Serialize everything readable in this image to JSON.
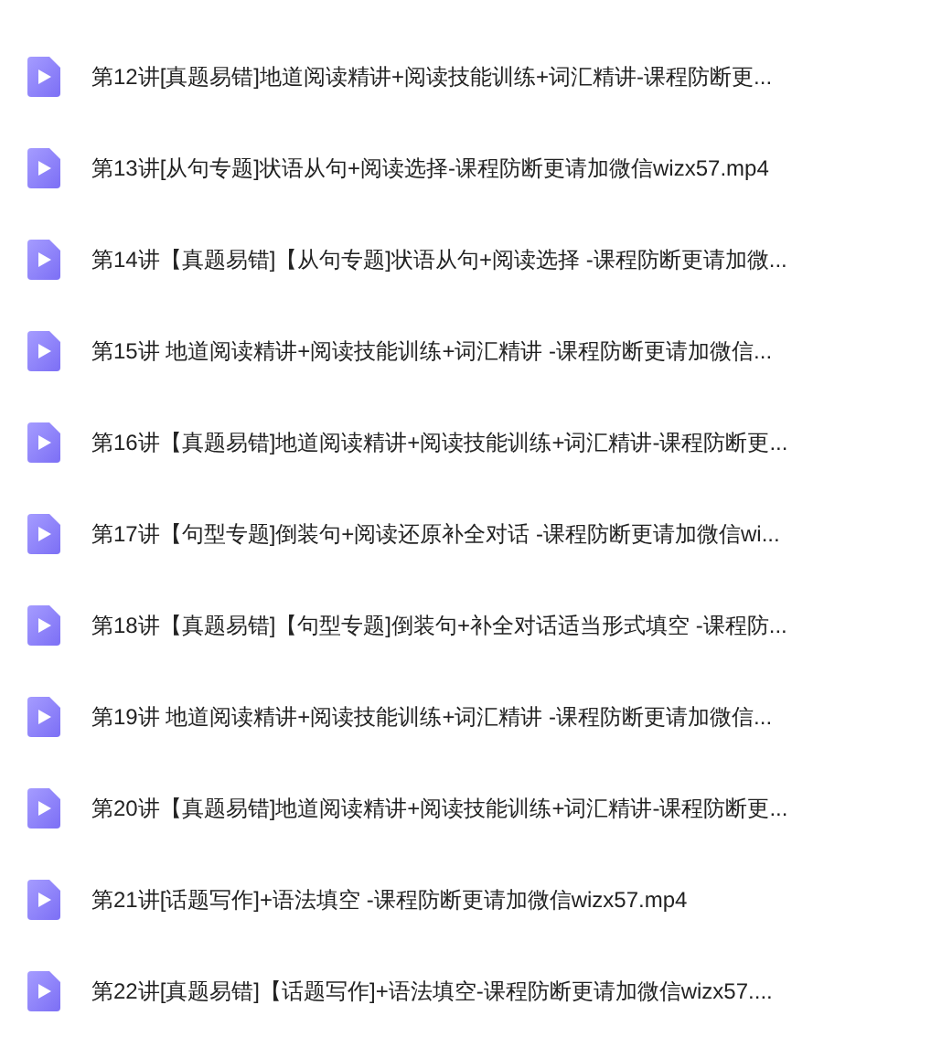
{
  "files": [
    {
      "name": "第12讲[真题易错]地道阅读精讲+阅读技能训练+词汇精讲-课程防断更..."
    },
    {
      "name": "第13讲[从句专题]状语从句+阅读选择-课程防断更请加微信wizx57.mp4"
    },
    {
      "name": "第14讲【真题易错]【从句专题]状语从句+阅读选择 -课程防断更请加微..."
    },
    {
      "name": "第15讲 地道阅读精讲+阅读技能训练+词汇精讲 -课程防断更请加微信..."
    },
    {
      "name": "第16讲【真题易错]地道阅读精讲+阅读技能训练+词汇精讲-课程防断更..."
    },
    {
      "name": "第17讲【句型专题]倒装句+阅读还原补全对话 -课程防断更请加微信wi..."
    },
    {
      "name": "第18讲【真题易错]【句型专题]倒装句+补全对话适当形式填空 -课程防..."
    },
    {
      "name": "第19讲 地道阅读精讲+阅读技能训练+词汇精讲 -课程防断更请加微信..."
    },
    {
      "name": "第20讲【真题易错]地道阅读精讲+阅读技能训练+词汇精讲-课程防断更..."
    },
    {
      "name": "第21讲[话题写作]+语法填空 -课程防断更请加微信wizx57.mp4"
    },
    {
      "name": "第22讲[真题易错]【话题写作]+语法填空-课程防断更请加微信wizx57...."
    }
  ]
}
